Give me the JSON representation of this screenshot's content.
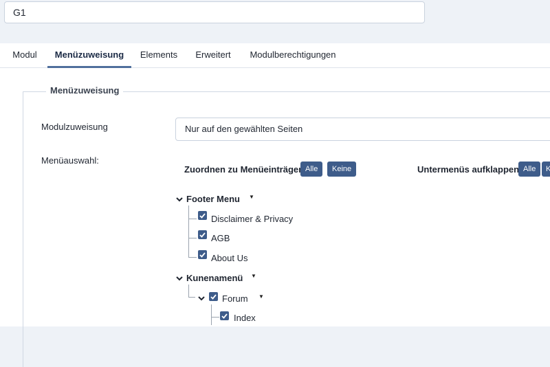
{
  "title_field": {
    "value": "G1"
  },
  "tabs": [
    {
      "label": "Modul"
    },
    {
      "label": "Menüzuweisung"
    },
    {
      "label": "Elements"
    },
    {
      "label": "Erweitert"
    },
    {
      "label": "Modulberechtigungen"
    }
  ],
  "active_tab": "Menüzuweisung",
  "section": {
    "legend": "Menüzuweisung",
    "assignment_label": "Modulzuweisung",
    "assignment_value": "Nur auf den gewählten Seiten",
    "menu_label": "Menüauswahl:",
    "assign_header": "Zuordnen zu Menüeinträgen",
    "assign_all": "Alle",
    "assign_none": "Keine",
    "expand_header": "Untermenüs aufklappen",
    "expand_all": "Alle",
    "expand_none": "K"
  },
  "tree": {
    "footer_menu": "Footer Menu",
    "footer_items": [
      "Disclaimer & Privacy",
      "AGB",
      "About Us"
    ],
    "kunden_menu": "Kunenamenü",
    "forum": "Forum",
    "forum_items": [
      "Index"
    ]
  },
  "colors": {
    "accent": "#3e5c8a",
    "tab_underline": "#4f6f9c",
    "background": "#eef2f7"
  },
  "icons": {
    "expanded": "chevron-down-icon",
    "dropdown": "caret-down-icon",
    "checkbox": "check-icon"
  }
}
